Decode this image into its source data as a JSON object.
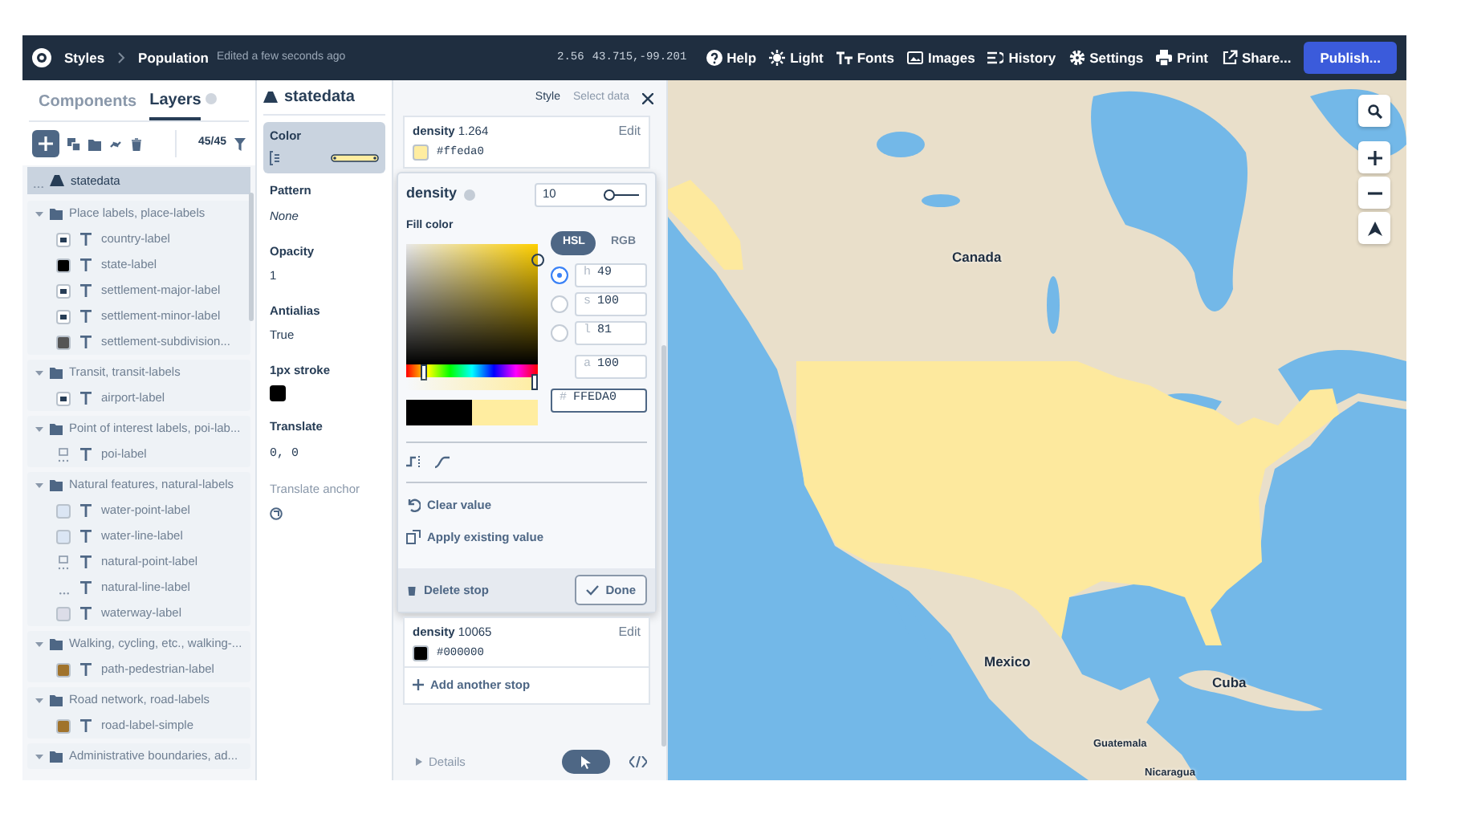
{
  "top_bar": {
    "breadcrumb": [
      "Styles",
      "Population"
    ],
    "status": "Edited a few seconds ago",
    "zoom": "2.56",
    "coords": "43.715,-99.201",
    "menu": [
      {
        "label": "Help"
      },
      {
        "label": "Light"
      },
      {
        "label": "Fonts"
      },
      {
        "label": "Images"
      },
      {
        "label": "History"
      },
      {
        "label": "Settings"
      },
      {
        "label": "Print"
      },
      {
        "label": "Share..."
      }
    ],
    "publish": "Publish..."
  },
  "left_panel": {
    "tabs": [
      {
        "label": "Components",
        "selected": false
      },
      {
        "label": "Layers",
        "selected": true
      }
    ],
    "count": "45/45",
    "selected_layer": {
      "name": "statedata",
      "selected": true
    },
    "groups": [
      {
        "name": "Place labels, place-labels",
        "expanded": true,
        "layers": [
          {
            "name": "country-label",
            "kind": "image"
          },
          {
            "name": "state-label",
            "kind": "color",
            "color": "#000000"
          },
          {
            "name": "settlement-major-label",
            "kind": "image"
          },
          {
            "name": "settlement-minor-label",
            "kind": "image"
          },
          {
            "name": "settlement-subdivision...",
            "kind": "color",
            "color": "#555555"
          }
        ]
      },
      {
        "name": "Transit, transit-labels",
        "expanded": true,
        "layers": [
          {
            "name": "airport-label",
            "kind": "image"
          }
        ]
      },
      {
        "name": "Point of interest labels, poi-lab...",
        "expanded": true,
        "layers": [
          {
            "name": "poi-label",
            "kind": "symbol"
          }
        ]
      },
      {
        "name": "Natural features, natural-labels",
        "expanded": true,
        "layers": [
          {
            "name": "water-point-label",
            "kind": "color",
            "color": "#dbe6f4"
          },
          {
            "name": "water-line-label",
            "kind": "color",
            "color": "#dbe6f4"
          },
          {
            "name": "natural-point-label",
            "kind": "symbol"
          },
          {
            "name": "natural-line-label",
            "kind": "dots"
          },
          {
            "name": "waterway-label",
            "kind": "color",
            "color": "#dcdde8"
          }
        ]
      },
      {
        "name": "Walking, cycling, etc., walking-...",
        "expanded": true,
        "layers": [
          {
            "name": "path-pedestrian-label",
            "kind": "color",
            "color": "#a0732c"
          }
        ]
      },
      {
        "name": "Road network, road-labels",
        "expanded": true,
        "layers": [
          {
            "name": "road-label-simple",
            "kind": "color",
            "color": "#a0732c"
          }
        ]
      },
      {
        "name": "Administrative boundaries, ad...",
        "expanded": true
      }
    ]
  },
  "properties_panel": {
    "title": "statedata",
    "properties": [
      {
        "label": "Color",
        "kind": "ramp",
        "selected": true,
        "color": "#ffeda0"
      },
      {
        "label": "Pattern",
        "kind": "italic",
        "value": "None",
        "selected": false
      },
      {
        "label": "Opacity",
        "kind": "text",
        "value": "1",
        "selected": false
      },
      {
        "label": "Antialias",
        "kind": "text",
        "value": "True",
        "selected": false
      },
      {
        "label": "1px stroke",
        "kind": "swatch",
        "color": "#000000",
        "selected": false
      },
      {
        "label": "Translate",
        "kind": "mono",
        "value": "0, 0",
        "selected": false
      },
      {
        "label": "Translate anchor",
        "kind": "anchor",
        "selected": false
      }
    ]
  },
  "editor": {
    "tabs": [
      {
        "label": "Style",
        "selected": true
      },
      {
        "label": "Select data",
        "selected": false
      }
    ],
    "stops": [
      {
        "property": "density",
        "value": "1.264",
        "hex": "#ffeda0",
        "color": "#ffeda0",
        "edit": "Edit"
      },
      {
        "property": "density",
        "value": "10065",
        "hex": "#000000",
        "color": "#000000",
        "edit": "Edit"
      }
    ],
    "popover": {
      "property": "density",
      "input": "10",
      "level": 0,
      "fill_label": "Fill color",
      "modes": [
        {
          "label": "HSL",
          "selected": true
        },
        {
          "label": "RGB",
          "selected": false
        }
      ],
      "channels": [
        {
          "label": "h",
          "value": "49",
          "selected": true
        },
        {
          "label": "s",
          "value": "100",
          "selected": false
        },
        {
          "label": "l",
          "value": "81",
          "selected": false
        }
      ],
      "alpha": {
        "label": "a",
        "value": "100"
      },
      "hex": {
        "label": "#",
        "value": "FFEDA0"
      },
      "hue_slider": {
        "level": 0.136
      },
      "alpha_slider": {
        "level": 1
      },
      "preview": [
        {
          "color": "#000000"
        },
        {
          "color": "#ffeda0"
        }
      ],
      "actions": [
        "Clear value",
        "Apply existing value"
      ],
      "delete": "Delete stop",
      "done": "Done"
    },
    "add_stop": "Add another stop",
    "details": "Details"
  },
  "map": {
    "labels": [
      {
        "text": "Canada",
        "kind": "country"
      },
      {
        "text": "Mexico",
        "kind": "country"
      },
      {
        "text": "Cuba",
        "kind": "country"
      },
      {
        "text": "Guatemala",
        "kind": "small"
      },
      {
        "text": "Nicaragua",
        "kind": "small"
      }
    ]
  }
}
